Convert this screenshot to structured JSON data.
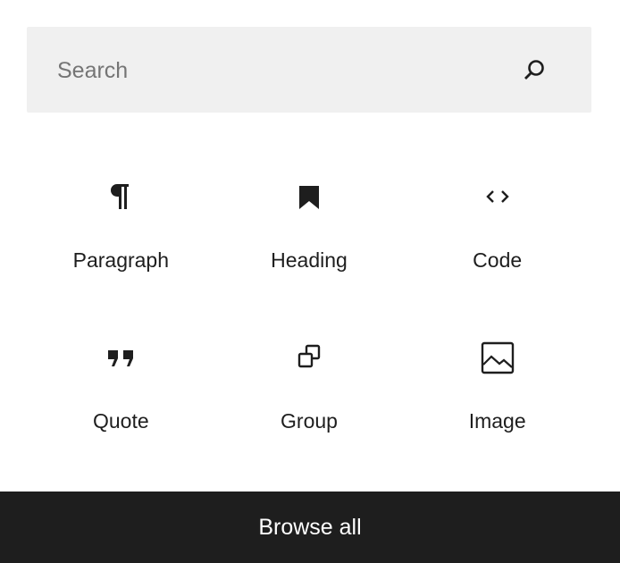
{
  "search": {
    "placeholder": "Search"
  },
  "blocks": [
    {
      "label": "Paragraph",
      "icon": "paragraph-icon"
    },
    {
      "label": "Heading",
      "icon": "bookmark-icon"
    },
    {
      "label": "Code",
      "icon": "code-icon"
    },
    {
      "label": "Quote",
      "icon": "quote-icon"
    },
    {
      "label": "Group",
      "icon": "group-icon"
    },
    {
      "label": "Image",
      "icon": "image-icon"
    }
  ],
  "footer": {
    "browse_label": "Browse all"
  }
}
